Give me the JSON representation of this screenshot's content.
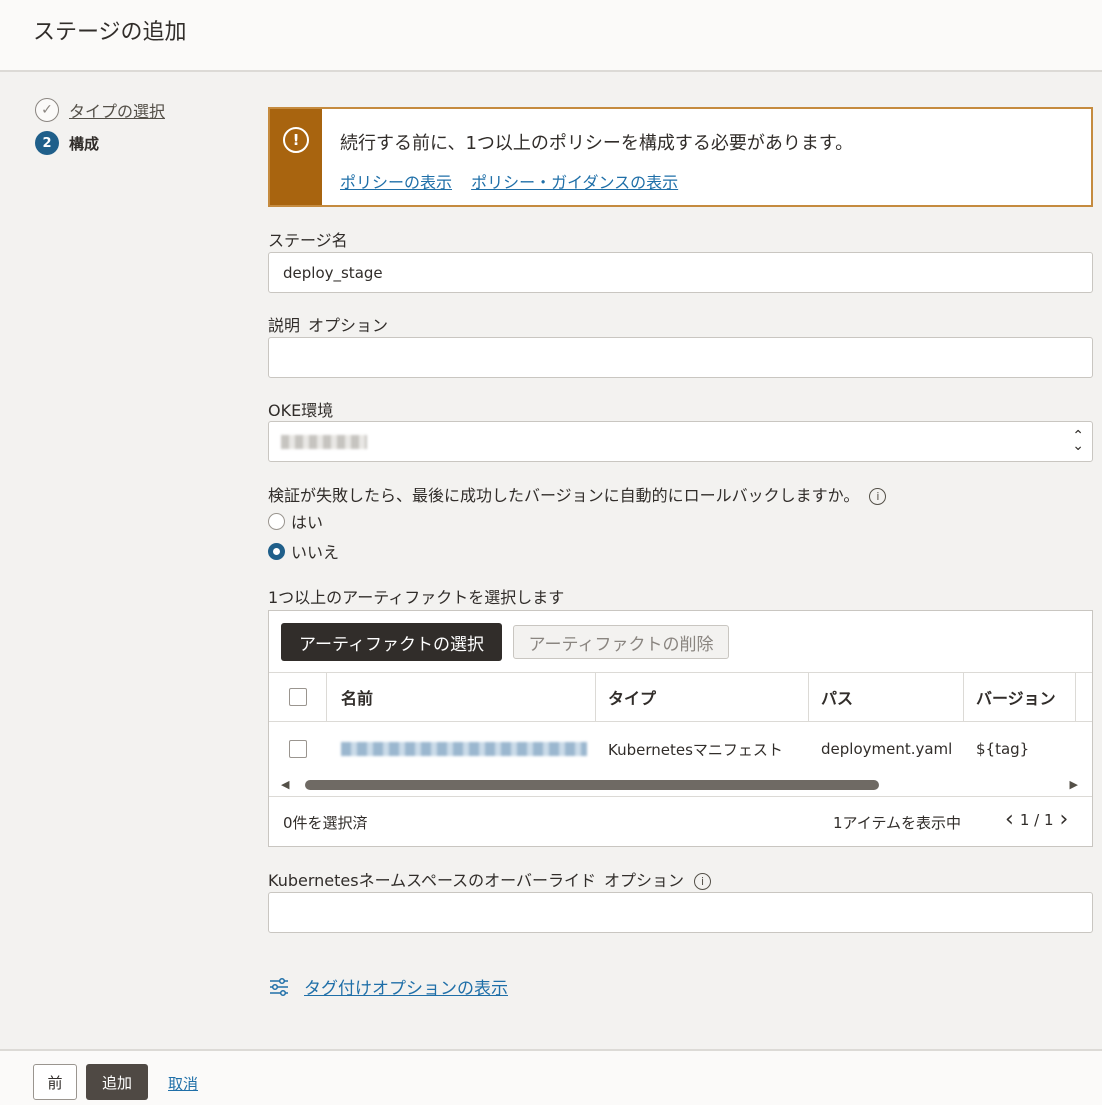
{
  "header": {
    "title": "ステージの追加"
  },
  "steps": [
    {
      "label": "タイプの選択",
      "status": "completed"
    },
    {
      "number": "2",
      "label": "構成",
      "status": "current"
    }
  ],
  "alert": {
    "message": "続行する前に、1つ以上のポリシーを構成する必要があります。",
    "link_policies": "ポリシーの表示",
    "link_guidance": "ポリシー・ガイダンスの表示",
    "icon": "exclamation-icon",
    "color": "#a8640f"
  },
  "form": {
    "stage_name_label": "ステージ名",
    "stage_name_value": "deploy_stage",
    "description_label": "説明",
    "description_optional": "オプション",
    "description_value": "",
    "oke_label": "OKE環境",
    "rollback_question": "検証が失敗したら、最後に成功したバージョンに自動的にロールバックしますか。",
    "rollback_yes": "はい",
    "rollback_no": "いいえ",
    "rollback_selected": "いいえ",
    "artifacts_label": "1つ以上のアーティファクトを選択します",
    "namespace_label": "Kubernetesネームスペースのオーバーライド",
    "namespace_optional": "オプション",
    "namespace_value": ""
  },
  "artifacts": {
    "select_button": "アーティファクトの選択",
    "remove_button": "アーティファクトの削除",
    "columns": [
      "名前",
      "タイプ",
      "パス",
      "バージョン"
    ],
    "rows": [
      {
        "name": "",
        "type": "Kubernetesマニフェスト",
        "path": "deployment.yaml",
        "version": "${tag}"
      }
    ],
    "selected_count": "0件を選択済",
    "items_shown": "1アイテムを表示中",
    "pagination": "1 / 1"
  },
  "tag_options_link": "タグ付けオプションの表示",
  "footer": {
    "prev": "前",
    "add": "追加",
    "cancel": "取消"
  },
  "colors": {
    "accent": "#1f5f8a",
    "link": "#1f6fa8",
    "warning": "#a8640f"
  }
}
